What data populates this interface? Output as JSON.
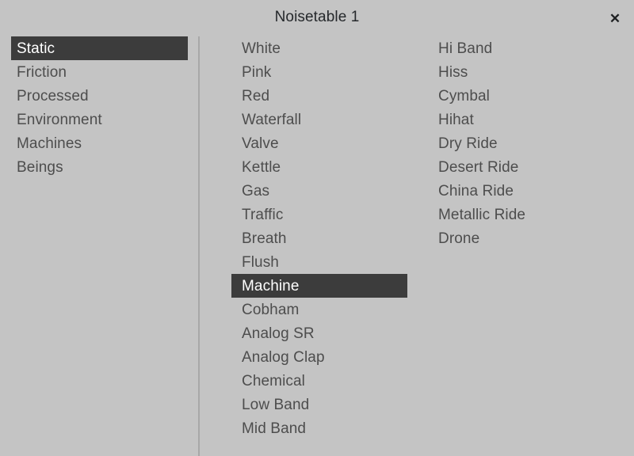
{
  "window": {
    "title": "Noisetable 1",
    "close_label": "✕",
    "background_color": "#c4c4c4",
    "selection_color": "#3c3c3c",
    "text_color": "#4d4d4d",
    "selected_text_color": "#ffffff",
    "divider_color": "#a8a8a8"
  },
  "categories": {
    "selected": "Static",
    "items": [
      {
        "label": "Static",
        "selected": true
      },
      {
        "label": "Friction",
        "selected": false
      },
      {
        "label": "Processed",
        "selected": false
      },
      {
        "label": "Environment",
        "selected": false
      },
      {
        "label": "Machines",
        "selected": false
      },
      {
        "label": "Beings",
        "selected": false
      }
    ]
  },
  "presets": {
    "selected": "Machine",
    "column_1": [
      {
        "label": "White",
        "selected": false
      },
      {
        "label": "Pink",
        "selected": false
      },
      {
        "label": "Red",
        "selected": false
      },
      {
        "label": "Waterfall",
        "selected": false
      },
      {
        "label": "Valve",
        "selected": false
      },
      {
        "label": "Kettle",
        "selected": false
      },
      {
        "label": "Gas",
        "selected": false
      },
      {
        "label": "Traffic",
        "selected": false
      },
      {
        "label": "Breath",
        "selected": false
      },
      {
        "label": "Flush",
        "selected": false
      },
      {
        "label": "Machine",
        "selected": true
      },
      {
        "label": "Cobham",
        "selected": false
      },
      {
        "label": "Analog SR",
        "selected": false
      },
      {
        "label": "Analog Clap",
        "selected": false
      },
      {
        "label": "Chemical",
        "selected": false
      },
      {
        "label": "Low Band",
        "selected": false
      },
      {
        "label": "Mid Band",
        "selected": false
      }
    ],
    "column_2": [
      {
        "label": "Hi Band",
        "selected": false
      },
      {
        "label": "Hiss",
        "selected": false
      },
      {
        "label": "Cymbal",
        "selected": false
      },
      {
        "label": "Hihat",
        "selected": false
      },
      {
        "label": "Dry Ride",
        "selected": false
      },
      {
        "label": "Desert Ride",
        "selected": false
      },
      {
        "label": "China Ride",
        "selected": false
      },
      {
        "label": "Metallic Ride",
        "selected": false
      },
      {
        "label": "Drone",
        "selected": false
      }
    ]
  }
}
